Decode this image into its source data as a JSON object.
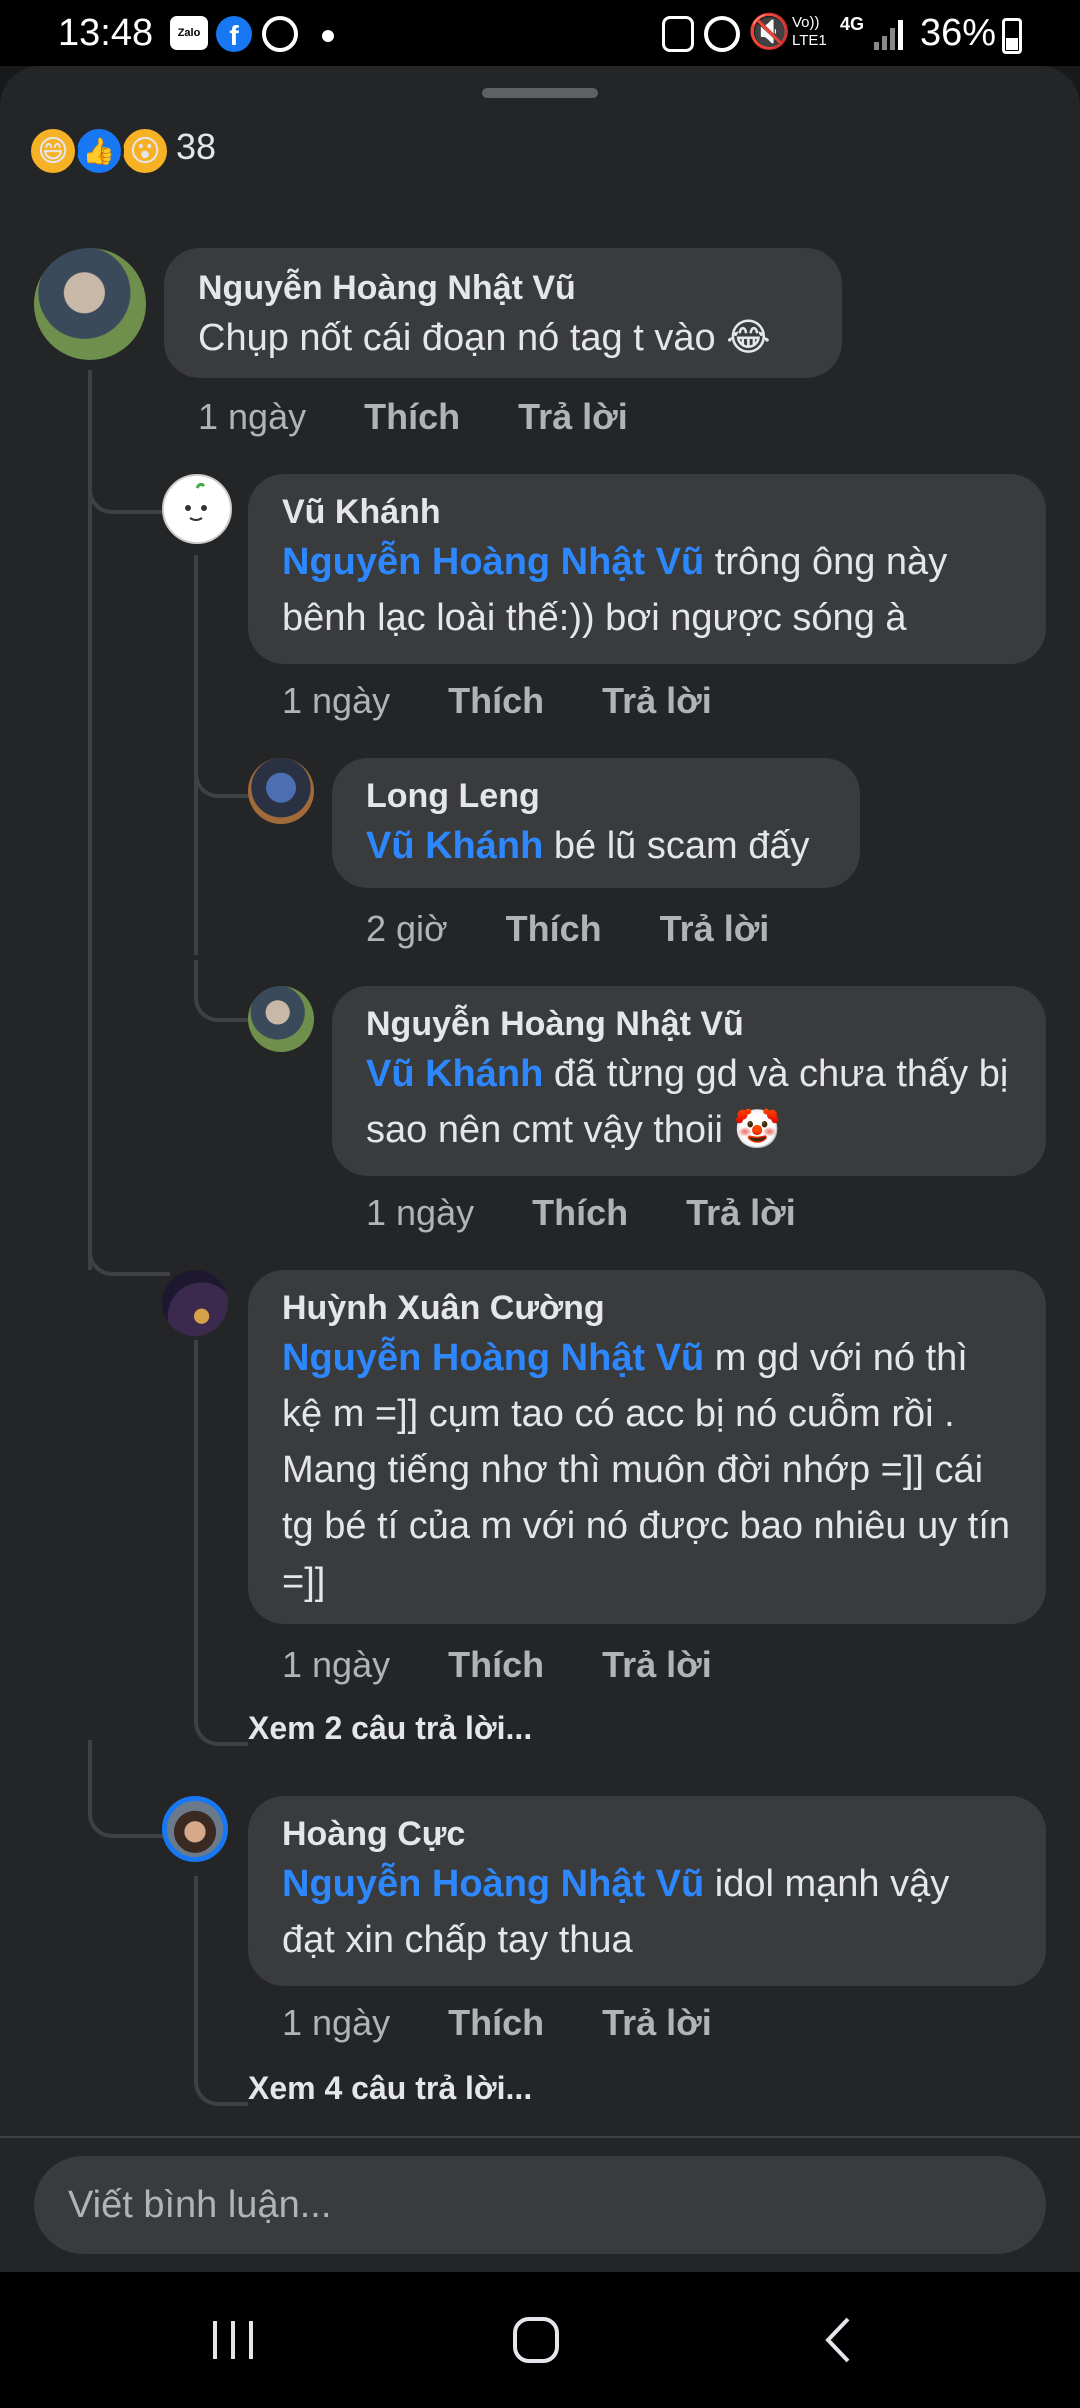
{
  "status_bar": {
    "time": "13:48",
    "left_icons": [
      "zalo-icon",
      "facebook-icon",
      "chrome-icon",
      "dot-icon"
    ],
    "right_icons": [
      "recycle-icon",
      "alarm-icon",
      "mute-icon",
      "volte-icon",
      "4g-icon",
      "signal-icon",
      "battery-icon"
    ],
    "zalo_label": "Zalo",
    "volte_label": "Vo)) LTE1",
    "network_label": "4G",
    "battery": "36%"
  },
  "reactions": {
    "icons": [
      "haha-icon",
      "like-icon",
      "wow-icon"
    ],
    "count": "38"
  },
  "comments": [
    {
      "author": "Nguyễn Hoàng Nhật Vũ",
      "mention": "",
      "text": "Chụp nốt cái đoạn nó tag t vào 😂",
      "time": "1 ngày",
      "like": "Thích",
      "reply": "Trả lời"
    },
    {
      "author": "Vũ Khánh",
      "mention": "Nguyễn Hoàng Nhật Vũ",
      "text": " trông ông này bênh lạc loài thế:)) bơi ngược sóng à",
      "time": "1 ngày",
      "like": "Thích",
      "reply": "Trả lời"
    },
    {
      "author": "Long Leng",
      "mention": "Vũ Khánh",
      "text": " bé lũ scam đấy",
      "time": "2 giờ",
      "like": "Thích",
      "reply": "Trả lời"
    },
    {
      "author": "Nguyễn Hoàng Nhật Vũ",
      "mention": "Vũ Khánh",
      "text": " đã từng gd và chưa thấy bị sao nên cmt vậy thoii 🤡",
      "time": "1 ngày",
      "like": "Thích",
      "reply": "Trả lời"
    },
    {
      "author": "Huỳnh Xuân Cường",
      "mention": "Nguyễn Hoàng Nhật Vũ",
      "text": " m gd với nó thì kệ m =]] cụm tao có acc bị nó cuỗm rồi . Mang tiếng nhơ thì muôn đời nhớp =]] cái tg bé tí của m với nó được bao nhiêu uy tín =]]",
      "time": "1 ngày",
      "like": "Thích",
      "reply": "Trả lời",
      "more": "Xem 2 câu trả lời..."
    },
    {
      "author": "Hoàng Cực",
      "mention": "Nguyễn Hoàng Nhật Vũ",
      "text": " idol mạnh vậy đạt xin chấp tay thua",
      "time": "1 ngày",
      "like": "Thích",
      "reply": "Trả lời",
      "more": "Xem 4 câu trả lời..."
    }
  ],
  "composer": {
    "placeholder": "Viết bình luận..."
  },
  "nav": {
    "icons": [
      "recents-icon",
      "home-icon",
      "back-icon"
    ]
  }
}
